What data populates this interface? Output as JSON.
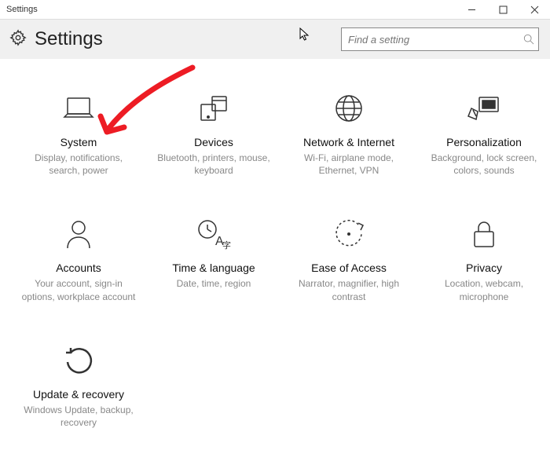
{
  "titlebar": {
    "text": "Settings"
  },
  "header": {
    "title": "Settings"
  },
  "search": {
    "placeholder": "Find a setting"
  },
  "tiles": {
    "system": {
      "title": "System",
      "desc": "Display, notifications, search, power"
    },
    "devices": {
      "title": "Devices",
      "desc": "Bluetooth, printers, mouse, keyboard"
    },
    "network": {
      "title": "Network & Internet",
      "desc": "Wi-Fi, airplane mode, Ethernet, VPN"
    },
    "personal": {
      "title": "Personalization",
      "desc": "Background, lock screen, colors, sounds"
    },
    "accounts": {
      "title": "Accounts",
      "desc": "Your account, sign-in options, workplace account"
    },
    "time": {
      "title": "Time & language",
      "desc": "Date, time, region"
    },
    "ease": {
      "title": "Ease of Access",
      "desc": "Narrator, magnifier, high contrast"
    },
    "privacy": {
      "title": "Privacy",
      "desc": "Location, webcam, microphone"
    },
    "update": {
      "title": "Update & recovery",
      "desc": "Windows Update, backup, recovery"
    }
  },
  "colors": {
    "arrow": "#ed1c24"
  }
}
